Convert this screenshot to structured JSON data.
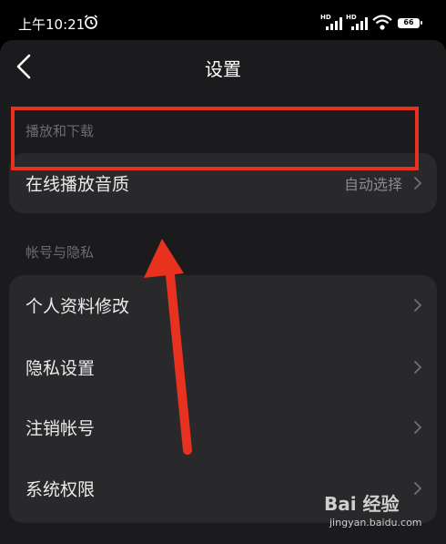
{
  "status_bar": {
    "time": "上午10:21",
    "signal1_label": "HD",
    "signal2_label": "HD",
    "battery": "66"
  },
  "header": {
    "title": "设置"
  },
  "sections": [
    {
      "label": "播放和下载",
      "rows": [
        {
          "label": "在线播放音质",
          "value": "自动选择"
        }
      ]
    },
    {
      "label": "帐号与隐私",
      "rows": [
        {
          "label": "个人资料修改"
        },
        {
          "label": "隐私设置"
        },
        {
          "label": "注销帐号"
        },
        {
          "label": "系统权限"
        }
      ]
    }
  ],
  "annotation": {
    "highlight_color": "#e8321f"
  },
  "watermark": {
    "brand": "Bai  经验",
    "url": "jingyan.baidu.com"
  }
}
